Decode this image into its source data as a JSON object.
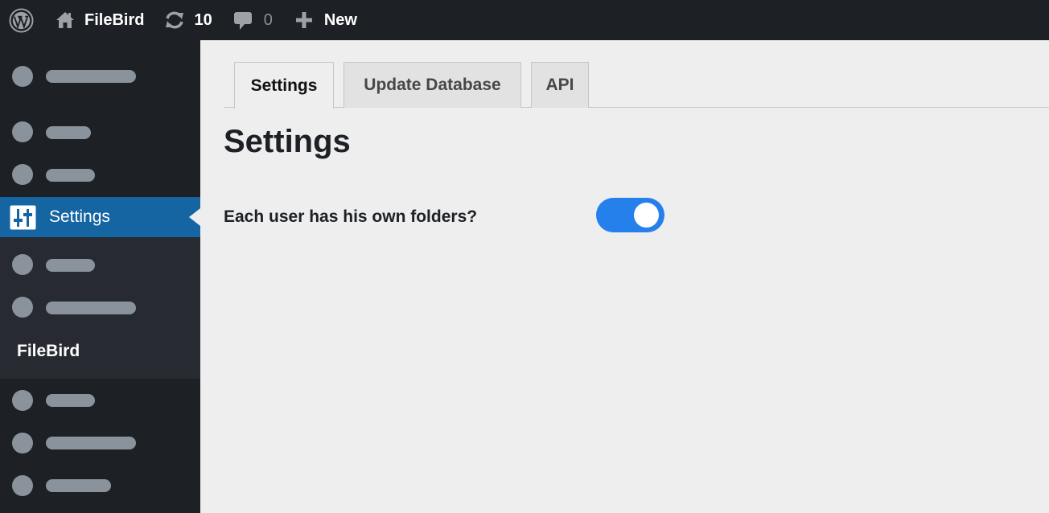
{
  "topbar": {
    "logo_icon": "wordpress-logo-icon",
    "site_name": "FileBird",
    "site_icon": "home-icon",
    "updates_icon": "refresh-icon",
    "updates_count": "10",
    "comments_icon": "comment-bubble-icon",
    "comments_count": "0",
    "new_icon": "plus-icon",
    "new_label": "New"
  },
  "sidebar": {
    "active_item": {
      "label": "Settings",
      "icon": "settings-sliders-icon"
    },
    "submenu": {
      "current_item": "FileBird"
    },
    "placeholder_items_count": 8
  },
  "main": {
    "tabs": [
      {
        "label": "Settings",
        "active": true
      },
      {
        "label": "Update Database",
        "active": false
      },
      {
        "label": "API",
        "active": false
      }
    ],
    "title": "Settings",
    "options": [
      {
        "label": "Each user has his own folders?",
        "enabled": true
      }
    ]
  },
  "colors": {
    "admin_bar": "#1d2025",
    "active_menu": "#1565a3",
    "toggle_on": "#2680eb",
    "content_bg": "#eeeeee"
  }
}
